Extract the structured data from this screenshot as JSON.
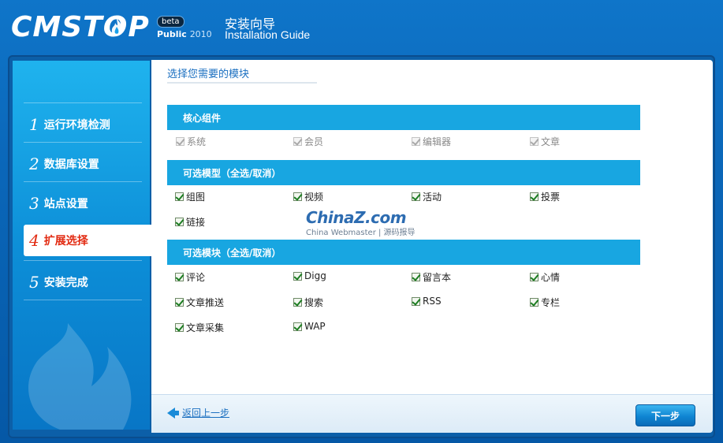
{
  "header": {
    "logo_text": "CMSTOP",
    "beta": "beta",
    "edition": "Public",
    "edition_year": "2010",
    "title_cn": "安装向导",
    "title_en": "Installation Guide"
  },
  "steps": [
    {
      "num": "1",
      "label": "运行环境检测",
      "active": false
    },
    {
      "num": "2",
      "label": "数据库设置",
      "active": false
    },
    {
      "num": "3",
      "label": "站点设置",
      "active": false
    },
    {
      "num": "4",
      "label": "扩展选择",
      "active": true
    },
    {
      "num": "5",
      "label": "安装完成",
      "active": false
    }
  ],
  "content": {
    "title": "选择您需要的模块",
    "core": {
      "header": "核心组件",
      "items": [
        {
          "label": "系统",
          "checked": true,
          "disabled": true
        },
        {
          "label": "会员",
          "checked": true,
          "disabled": true
        },
        {
          "label": "编辑器",
          "checked": true,
          "disabled": true
        },
        {
          "label": "文章",
          "checked": true,
          "disabled": true
        }
      ]
    },
    "models": {
      "header": "可选模型（全选/取消）",
      "items": [
        {
          "label": "组图",
          "checked": true
        },
        {
          "label": "视频",
          "checked": true
        },
        {
          "label": "活动",
          "checked": true
        },
        {
          "label": "投票",
          "checked": true
        },
        {
          "label": "链接",
          "checked": true
        }
      ]
    },
    "modules": {
      "header": "可选模块（全选/取消）",
      "items": [
        {
          "label": "评论",
          "checked": true
        },
        {
          "label": "Digg",
          "checked": true
        },
        {
          "label": "留言本",
          "checked": true
        },
        {
          "label": "心情",
          "checked": true
        },
        {
          "label": "文章推送",
          "checked": true
        },
        {
          "label": "搜索",
          "checked": true
        },
        {
          "label": "RSS",
          "checked": true
        },
        {
          "label": "专栏",
          "checked": true
        },
        {
          "label": "文章采集",
          "checked": true
        },
        {
          "label": "WAP",
          "checked": true
        }
      ]
    }
  },
  "watermark": {
    "main": "ChinaZ.com",
    "sub": "China Webmaster | 源码报导"
  },
  "footer": {
    "back_label": "返回上一步",
    "next_label": "下一步"
  },
  "colors": {
    "accent_bar": "#18a6e1",
    "active_step_text": "#e22b12",
    "link": "#1a6fc0"
  }
}
